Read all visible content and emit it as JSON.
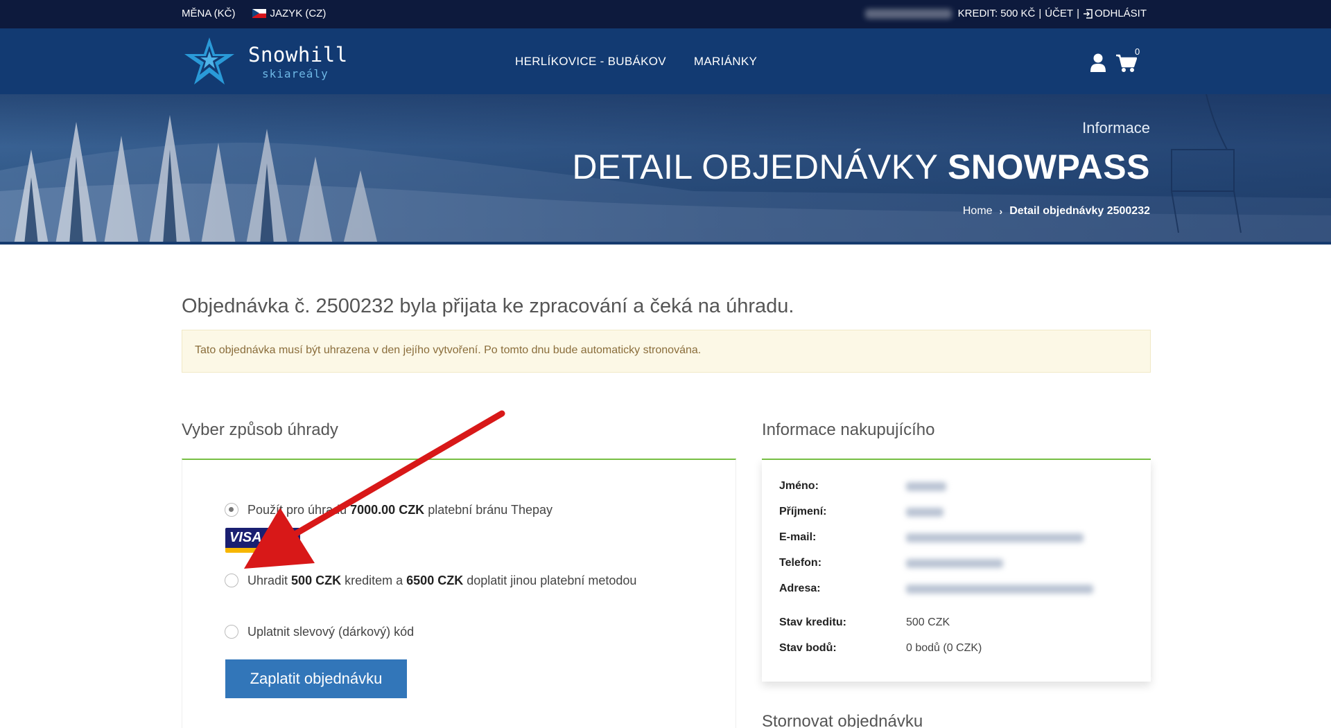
{
  "topbar": {
    "currency": "MĚNA (KČ)",
    "language": "JAZYK (CZ)",
    "credit": "KREDIT: 500 KČ",
    "separator": "|",
    "account": "ÚČET",
    "logout": "ODHLÁSIT"
  },
  "logo": {
    "brand": "Snowhill",
    "sub": "skiareály"
  },
  "nav": {
    "items": [
      "HERLÍKOVICE - BUBÁKOV",
      "MARIÁNKY"
    ]
  },
  "cart": {
    "count": "0"
  },
  "hero": {
    "label": "Informace",
    "title_light": "DETAIL OBJEDNÁVKY",
    "title_bold": "SNOWPASS",
    "crumb_home": "Home",
    "crumb_sep": "›",
    "crumb_current": "Detail objednávky 2500232"
  },
  "order": {
    "heading": "Objednávka č. 2500232 byla přijata ke zpracování a čeká na úhradu.",
    "alert": "Tato objednávka musí být uhrazena v den jejího vytvoření. Po tomto dnu bude automaticky stronována."
  },
  "payment": {
    "title": "Vyber způsob úhrady",
    "option1": {
      "pre": "Použít pro úhradu",
      "amount": "7000.00 CZK",
      "post": "platební bránu Thepay",
      "selected": true
    },
    "card_logo": "VISA",
    "option2": {
      "pre": "Uhradit",
      "credit": "500 CZK",
      "mid": "kreditem a",
      "rest": "6500 CZK",
      "post": "doplatit jinou platební metodou"
    },
    "option3": {
      "label": "Uplatnit slevový (dárkový) kód"
    },
    "button": "Zaplatit objednávku"
  },
  "buyer": {
    "title": "Informace nakupujícího",
    "rows": [
      {
        "label": "Jméno:"
      },
      {
        "label": "Příjmení:"
      },
      {
        "label": "E-mail:"
      },
      {
        "label": "Telefon:"
      },
      {
        "label": "Adresa:"
      }
    ],
    "credit_label": "Stav kreditu:",
    "credit_value": "500 CZK",
    "points_label": "Stav bodů:",
    "points_value": "0 bodů (0 CZK)"
  },
  "storno": {
    "title": "Stornovat objednávku"
  },
  "colors": {
    "topbar": "#0d1a3d",
    "navbar": "#123a72",
    "accent_green": "#76bf43",
    "button_blue": "#3276b9",
    "annotation_red": "#d81818"
  }
}
